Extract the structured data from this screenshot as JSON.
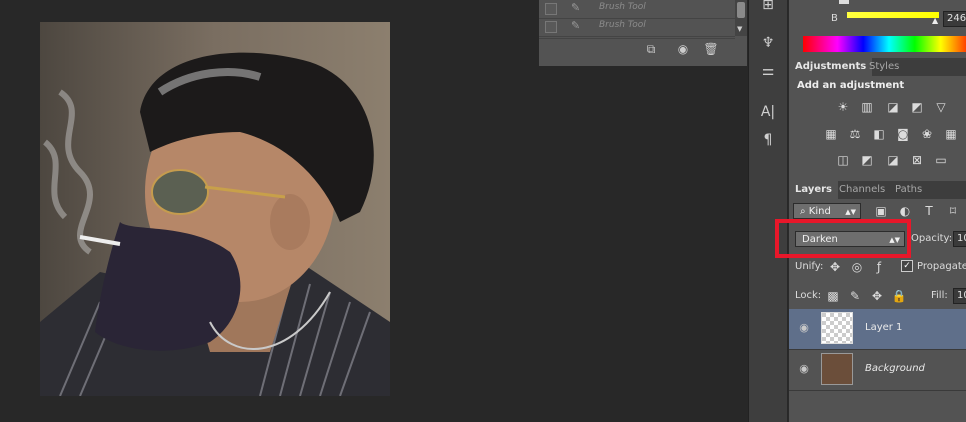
{
  "history": {
    "items": [
      {
        "label": "Brush Tool"
      },
      {
        "label": "Brush Tool"
      }
    ]
  },
  "color": {
    "b_label": "B",
    "b_value": "246"
  },
  "adjustments": {
    "tabs": [
      "Adjustments",
      "Styles"
    ],
    "heading": "Add an adjustment"
  },
  "layers": {
    "tabs": [
      "Layers",
      "Channels",
      "Paths"
    ],
    "filter_kind": "Kind",
    "blend_mode": "Darken",
    "opacity_label": "Opacity:",
    "opacity_value": "10",
    "unify_label": "Unify:",
    "propagate_label": "Propagate",
    "lock_label": "Lock:",
    "fill_label": "Fill:",
    "fill_value": "10",
    "items": [
      {
        "name": "Layer 1",
        "selected": true
      },
      {
        "name": "Background",
        "selected": false
      }
    ]
  },
  "colors": {
    "highlight": "#e8172a",
    "selected_layer": "#5f6f8a"
  }
}
